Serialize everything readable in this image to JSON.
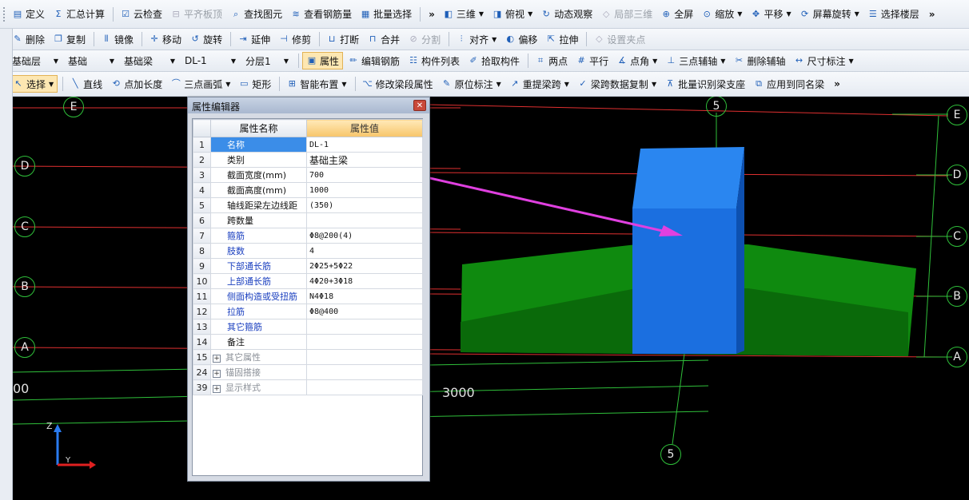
{
  "toolbar_row1": [
    {
      "label": "定义",
      "icon": "define-icon"
    },
    {
      "label": "汇总计算",
      "icon": "sigma-icon"
    },
    {
      "label": "云检查",
      "icon": "cloud-check-icon"
    },
    {
      "label": "平齐板顶",
      "icon": "align-top-icon",
      "disabled": true
    },
    {
      "label": "查找图元",
      "icon": "find-icon"
    },
    {
      "label": "查看钢筋量",
      "icon": "rebar-view-icon"
    },
    {
      "label": "批量选择",
      "icon": "batch-select-icon"
    },
    {
      "label": "三维",
      "icon": "3d-icon",
      "dropdown": true
    },
    {
      "label": "俯视",
      "icon": "top-view-icon",
      "dropdown": true
    },
    {
      "label": "动态观察",
      "icon": "orbit-icon"
    },
    {
      "label": "局部三维",
      "icon": "local-3d-icon",
      "disabled": true
    },
    {
      "label": "全屏",
      "icon": "fullscreen-icon"
    },
    {
      "label": "缩放",
      "icon": "zoom-icon",
      "dropdown": true
    },
    {
      "label": "平移",
      "icon": "pan-icon",
      "dropdown": true
    },
    {
      "label": "屏幕旋转",
      "icon": "rotate-screen-icon",
      "dropdown": true
    },
    {
      "label": "选择楼层",
      "icon": "floor-select-icon"
    }
  ],
  "toolbar_row2": [
    {
      "label": "删除",
      "icon": "delete-icon"
    },
    {
      "label": "复制",
      "icon": "copy-icon"
    },
    {
      "label": "镜像",
      "icon": "mirror-icon"
    },
    {
      "label": "移动",
      "icon": "move-icon"
    },
    {
      "label": "旋转",
      "icon": "rotate-icon"
    },
    {
      "label": "延伸",
      "icon": "extend-icon"
    },
    {
      "label": "修剪",
      "icon": "trim-icon"
    },
    {
      "label": "打断",
      "icon": "break-icon"
    },
    {
      "label": "合并",
      "icon": "merge-icon"
    },
    {
      "label": "分割",
      "icon": "split-icon",
      "disabled": true
    },
    {
      "label": "对齐",
      "icon": "align-icon",
      "dropdown": true
    },
    {
      "label": "偏移",
      "icon": "offset-icon"
    },
    {
      "label": "拉伸",
      "icon": "stretch-icon"
    },
    {
      "label": "设置夹点",
      "icon": "grip-point-icon",
      "disabled": true
    }
  ],
  "toolbar_row3": {
    "selects": [
      "基础层",
      "基础",
      "基础梁",
      "DL-1",
      "分层1"
    ],
    "items": [
      {
        "label": "属性",
        "icon": "properties-icon",
        "active": true
      },
      {
        "label": "编辑钢筋",
        "icon": "edit-rebar-icon"
      },
      {
        "label": "构件列表",
        "icon": "component-list-icon"
      },
      {
        "label": "拾取构件",
        "icon": "pick-component-icon"
      },
      {
        "label": "两点",
        "icon": "two-point-icon"
      },
      {
        "label": "平行",
        "icon": "parallel-icon"
      },
      {
        "label": "点角",
        "icon": "point-angle-icon",
        "dropdown": true
      },
      {
        "label": "三点辅轴",
        "icon": "three-point-axis-icon",
        "dropdown": true
      },
      {
        "label": "删除辅轴",
        "icon": "delete-axis-icon"
      },
      {
        "label": "尺寸标注",
        "icon": "dimension-icon",
        "dropdown": true
      }
    ]
  },
  "toolbar_row4": [
    {
      "label": "选择",
      "icon": "pointer-icon",
      "dropdown": true,
      "active": true
    },
    {
      "label": "直线",
      "icon": "line-icon"
    },
    {
      "label": "点加长度",
      "icon": "point-length-icon"
    },
    {
      "label": "三点画弧",
      "icon": "arc-icon",
      "dropdown": true
    },
    {
      "label": "矩形",
      "icon": "rectangle-icon"
    },
    {
      "label": "智能布置",
      "icon": "smart-layout-icon",
      "dropdown": true
    },
    {
      "label": "修改梁段属性",
      "icon": "beam-segment-icon"
    },
    {
      "label": "原位标注",
      "icon": "in-place-annotation-icon",
      "dropdown": true
    },
    {
      "label": "重提梁跨",
      "icon": "re-span-icon",
      "dropdown": true
    },
    {
      "label": "梁跨数据复制",
      "icon": "span-copy-icon",
      "dropdown": true
    },
    {
      "label": "批量识别梁支座",
      "icon": "batch-support-icon"
    },
    {
      "label": "应用到同名梁",
      "icon": "apply-same-icon"
    }
  ],
  "property_editor": {
    "title": "属性编辑器",
    "col_name": "属性名称",
    "col_value": "属性值",
    "rows": [
      {
        "num": "1",
        "name": "名称",
        "value": "DL-1",
        "selected": true
      },
      {
        "num": "2",
        "name": "类别",
        "value": "基础主梁",
        "black": true
      },
      {
        "num": "3",
        "name": "截面宽度(mm)",
        "value": "700",
        "black": true
      },
      {
        "num": "4",
        "name": "截面高度(mm)",
        "value": "1000",
        "black": true
      },
      {
        "num": "5",
        "name": "轴线距梁左边线距",
        "value": "(350)",
        "black": true
      },
      {
        "num": "6",
        "name": "跨数量",
        "value": "",
        "black": true
      },
      {
        "num": "7",
        "name": "箍筋",
        "value": "Φ8@200(4)"
      },
      {
        "num": "8",
        "name": "肢数",
        "value": "4"
      },
      {
        "num": "9",
        "name": "下部通长筋",
        "value": "2Φ25+5Φ22"
      },
      {
        "num": "10",
        "name": "上部通长筋",
        "value": "4Φ20+3Φ18"
      },
      {
        "num": "11",
        "name": "侧面构造或受扭筋",
        "value": "N4Φ18"
      },
      {
        "num": "12",
        "name": "拉筋",
        "value": "Φ8@400"
      },
      {
        "num": "13",
        "name": "其它箍筋",
        "value": ""
      },
      {
        "num": "14",
        "name": "备注",
        "value": "",
        "black": true
      },
      {
        "num": "15",
        "name": "其它属性",
        "value": "",
        "group": true
      },
      {
        "num": "24",
        "name": "锚固搭接",
        "value": "",
        "group": true
      },
      {
        "num": "39",
        "name": "显示样式",
        "value": "",
        "group": true
      }
    ]
  },
  "viewport": {
    "axis_labels_left": [
      "E",
      "D",
      "C",
      "B",
      "A"
    ],
    "axis_labels_right": [
      "E",
      "D",
      "C",
      "B",
      "A"
    ],
    "axis_label_top": "5",
    "axis_label_bottom": "5",
    "dimension_left": "00",
    "dimension_center": "3000",
    "coord_z": "Z",
    "coord_y": "Y",
    "colors": {
      "beam": "#1b73e8",
      "footing": "#0a7a0a",
      "axis_line": "#e03030",
      "grid_line": "#2fbf3a",
      "annotation": "#e040e0"
    }
  }
}
